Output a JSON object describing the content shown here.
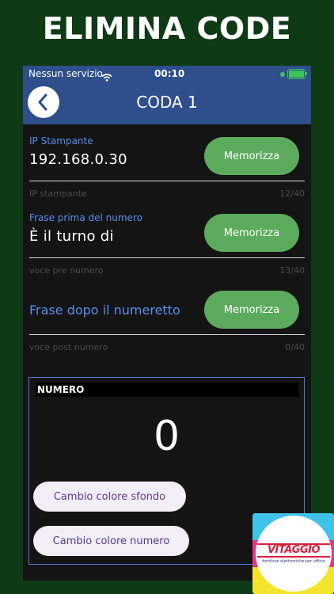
{
  "promo": {
    "title": "ELIMINA CODE"
  },
  "status_bar": {
    "carrier": "Nessun servizio",
    "time": "00:10"
  },
  "header": {
    "title": "CODA 1"
  },
  "fields": [
    {
      "label": "IP Stampante",
      "value": "192.168.0.30",
      "helper": "IP stampante",
      "counter": "12/40",
      "button": "Memorizza"
    },
    {
      "label": "Frase prima del numero",
      "value": "È il turno di",
      "helper": "voce pre numero",
      "counter": "13/40",
      "button": "Memorizza"
    },
    {
      "placeholder": "Frase dopo il numeretto",
      "value": "",
      "helper": "voce post numero",
      "counter": "0/40",
      "button": "Memorizza"
    }
  ],
  "numero": {
    "header": "NUMERO",
    "value": "0",
    "background_button": "Cambio colore sfondo",
    "number_button": "Cambio colore numero"
  },
  "logo": {
    "name": "VITAGGIO",
    "tagline": "forniture elettroniche per ufficio"
  },
  "colors": {
    "page_bg": "#0e3a16",
    "header_bg": "#2e4e8c",
    "accent_green": "#5cab5c",
    "label_blue": "#5b8ef0"
  }
}
